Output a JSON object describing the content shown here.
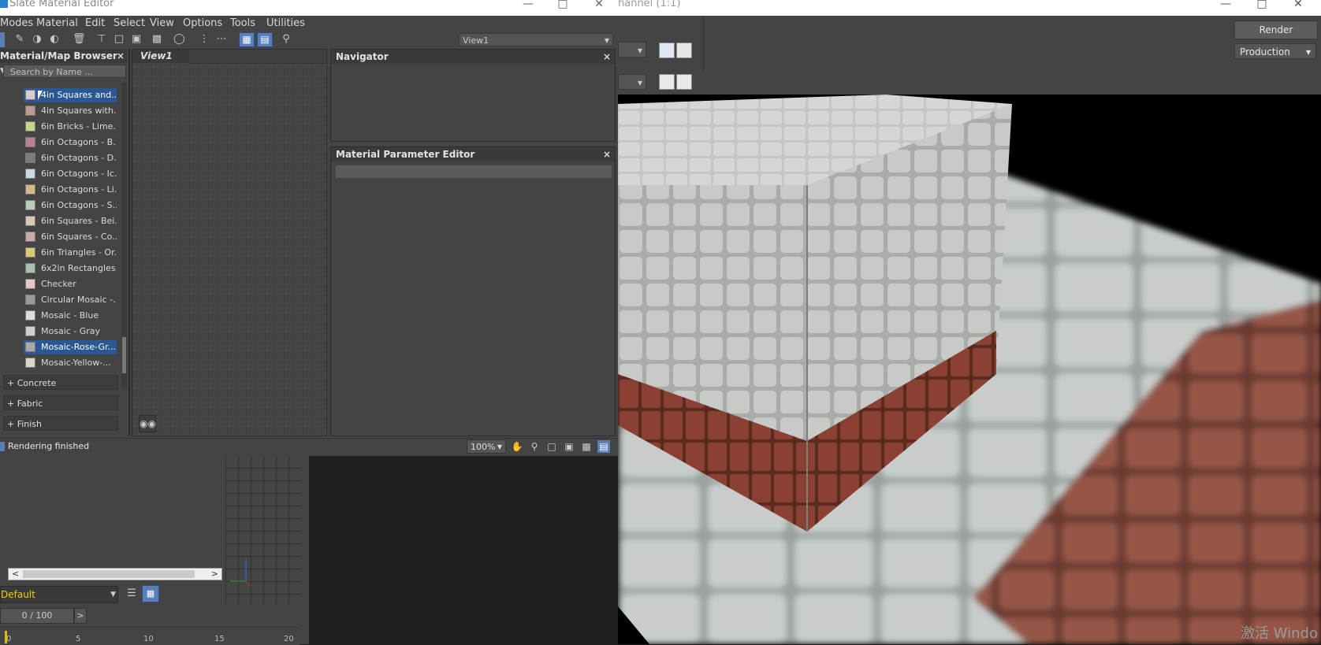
{
  "slate_editor": {
    "title": "Slate Material Editor",
    "menus": [
      "Modes",
      "Material",
      "Edit",
      "Select",
      "View",
      "Options",
      "Tools",
      "Utilities"
    ],
    "view_select": "View1",
    "browser": {
      "title": "Material/Map Browser",
      "search_placeholder": "Search by Name ...",
      "materials": [
        {
          "label": "4in Squares and...",
          "swatch": "#d8cbcf",
          "selected": true
        },
        {
          "label": "4in Squares with...",
          "swatch": "#b89c8f",
          "selected": false
        },
        {
          "label": "6in Bricks - Lime...",
          "swatch": "#c9d48b",
          "selected": false
        },
        {
          "label": "6in Octagons - B...",
          "swatch": "#b98198",
          "selected": false
        },
        {
          "label": "6in Octagons - D...",
          "swatch": "#7d7d7d",
          "selected": false
        },
        {
          "label": "6in Octagons - Ic...",
          "swatch": "#c5dbe0",
          "selected": false
        },
        {
          "label": "6in Octagons - Li...",
          "swatch": "#d1b98c",
          "selected": false
        },
        {
          "label": "6in Octagons - S...",
          "swatch": "#b8cdb9",
          "selected": false
        },
        {
          "label": "6in Squares - Bei...",
          "swatch": "#d8c9b4",
          "selected": false
        },
        {
          "label": "6in Squares - Co...",
          "swatch": "#c9a9a9",
          "selected": false
        },
        {
          "label": "6in Triangles - Or...",
          "swatch": "#d9c877",
          "selected": false
        },
        {
          "label": "6x2in Rectangles...",
          "swatch": "#a9c0b1",
          "selected": false
        },
        {
          "label": "Checker",
          "swatch": "#e4c8c8",
          "selected": false
        },
        {
          "label": "Circular Mosaic -...",
          "swatch": "#9a9a9a",
          "selected": false
        },
        {
          "label": "Mosaic - Blue",
          "swatch": "#d8dde4",
          "selected": false
        },
        {
          "label": "Mosaic - Gray",
          "swatch": "#cfcfcf",
          "selected": false
        },
        {
          "label": "Mosaic-Rose-Gr...",
          "swatch": "#a8a8a8",
          "selected": true
        },
        {
          "label": "Mosaic-Yellow-...",
          "swatch": "#d8d6c8",
          "selected": false
        }
      ],
      "categories": [
        "+ Concrete",
        "+ Fabric",
        "+ Finish"
      ]
    },
    "view_tab": "View1",
    "navigator_title": "Navigator",
    "param_editor_title": "Material Parameter Editor",
    "status": "Rendering finished",
    "zoom": "100%"
  },
  "render_frame": {
    "title_fragment": "hannel (1:1)",
    "render_button": "Render",
    "preset": "Production"
  },
  "max_ui": {
    "layer": "Default",
    "frame_counter": "0 / 100",
    "frame_next": ">",
    "timeline_ticks": [
      "0",
      "5",
      "10",
      "15",
      "20"
    ]
  },
  "watermark": "激活 Windo"
}
